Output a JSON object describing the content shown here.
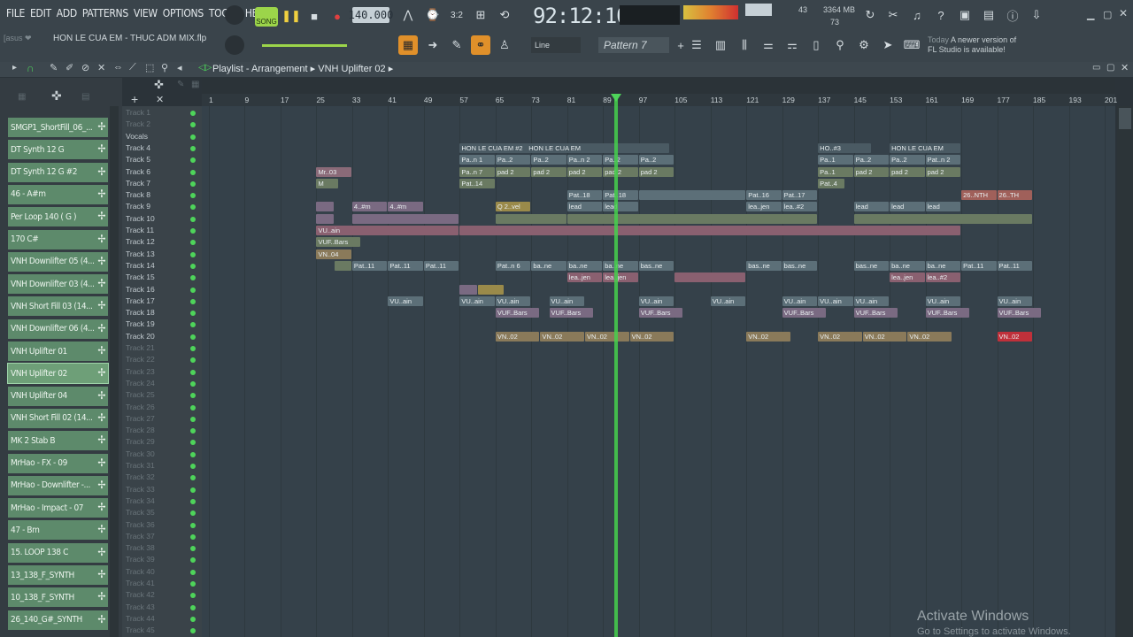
{
  "menu": [
    "FILE",
    "EDIT",
    "ADD",
    "PATTERNS",
    "VIEW",
    "OPTIONS",
    "TOOLS",
    "HELP"
  ],
  "transport": {
    "mode_label": "SONG",
    "tempo": "140.000",
    "time": "92:12:10",
    "cpu": "43",
    "mem": "3364 MB",
    "voices": "73"
  },
  "project": {
    "user": "[asus ❤",
    "file": "HON LE CUA EM - THUC ADM MIX.flp",
    "snap": "Line",
    "pattern": "Pattern 7"
  },
  "news": {
    "line1_prefix": "Today",
    "line1": "A newer version of",
    "line2": "FL Studio is available!"
  },
  "window": {
    "title": "Playlist - Arrangement",
    "sub": "VNH Uplifter 02"
  },
  "browser": [
    "SMGP1_ShortFill_06_...",
    "DT Synth 12 G",
    "DT Synth 12 G #2",
    "46 - A#m",
    "Per Loop 140 ( G )",
    "170 C#",
    "VNH Downlifter 05 (4...",
    "VNH Downlifter 03 (4...",
    "VNH Short Fill 03 (14...",
    "VNH Downlifter 06 (4...",
    "VNH Uplifter 01",
    "VNH Uplifter 02",
    "VNH Uplifter 04",
    "VNH Short Fill 02 (14...",
    "MK 2 Stab B",
    "MrHao - FX - 09",
    "MrHao - Downlifter -...",
    "MrHao - Impact - 07",
    "47 - Bm",
    "15. LOOP 138 C",
    "13_138_F_SYNTH",
    "10_138_F_SYNTH",
    "26_140_G#_SYNTH"
  ],
  "tracks": [
    "Track 1",
    "Track 2",
    "Vocals",
    "Track 4",
    "Track 5",
    "Track 6",
    "Track 7",
    "Track 8",
    "Track 9",
    "Track 10",
    "Track 11",
    "Track 12",
    "Track 13",
    "Track 14",
    "Track 15",
    "Track 16",
    "Track 17",
    "Track 18",
    "Track 19",
    "Track 20",
    "Track 21",
    "Track 22",
    "Track 23",
    "Track 24",
    "Track 25",
    "Track 26",
    "Track 27",
    "Track 28",
    "Track 29",
    "Track 30",
    "Track 31",
    "Track 32",
    "Track 33",
    "Track 34",
    "Track 35",
    "Track 36",
    "Track 37",
    "Track 38",
    "Track 39",
    "Track 40",
    "Track 41",
    "Track 42",
    "Track 43",
    "Track 44",
    "Track 45"
  ],
  "ruler": [
    "1",
    "9",
    "17",
    "25",
    "33",
    "41",
    "49",
    "57",
    "65",
    "73",
    "81",
    "89",
    "97",
    "105",
    "113",
    "121",
    "129",
    "137",
    "145",
    "153",
    "161",
    "169",
    "177",
    "185",
    "193",
    "201"
  ],
  "clips": [
    {
      "row": 3,
      "b": 57,
      "w": 16,
      "label": "HON LE CUA EM #2",
      "c": "#4a5a63"
    },
    {
      "row": 3,
      "b": 72,
      "w": 32,
      "label": "HON LE CUA EM",
      "c": "#4a5a63"
    },
    {
      "row": 3,
      "b": 137,
      "w": 12,
      "label": "HO..#3",
      "c": "#4a5a63"
    },
    {
      "row": 3,
      "b": 153,
      "w": 16,
      "label": "HON LE CUA EM",
      "c": "#4a5a63"
    },
    {
      "row": 4,
      "b": 57,
      "w": 8,
      "label": "Pa..n 1",
      "c": "#5c6f78"
    },
    {
      "row": 4,
      "b": 65,
      "w": 8,
      "label": "Pa..2",
      "c": "#5c6f78"
    },
    {
      "row": 4,
      "b": 73,
      "w": 8,
      "label": "Pa..2",
      "c": "#5c6f78"
    },
    {
      "row": 4,
      "b": 81,
      "w": 8,
      "label": "Pa..n 2",
      "c": "#5c6f78"
    },
    {
      "row": 4,
      "b": 89,
      "w": 8,
      "label": "Pa..2",
      "c": "#5c6f78"
    },
    {
      "row": 4,
      "b": 97,
      "w": 8,
      "label": "Pa..2",
      "c": "#5c6f78"
    },
    {
      "row": 4,
      "b": 137,
      "w": 8,
      "label": "Pa..1",
      "c": "#5c6f78"
    },
    {
      "row": 4,
      "b": 145,
      "w": 8,
      "label": "Pa..2",
      "c": "#5c6f78"
    },
    {
      "row": 4,
      "b": 153,
      "w": 8,
      "label": "Pa..2",
      "c": "#5c6f78"
    },
    {
      "row": 4,
      "b": 161,
      "w": 8,
      "label": "Pat..n 2",
      "c": "#5c6f78"
    },
    {
      "row": 5,
      "b": 25,
      "w": 8,
      "label": "Mr..03",
      "c": "#8a6a78"
    },
    {
      "row": 5,
      "b": 57,
      "w": 8,
      "label": "Pa..n 7",
      "c": "#6a7a62"
    },
    {
      "row": 5,
      "b": 65,
      "w": 8,
      "label": "pad 2",
      "c": "#6a7a62"
    },
    {
      "row": 5,
      "b": 73,
      "w": 8,
      "label": "pad 2",
      "c": "#6a7a62"
    },
    {
      "row": 5,
      "b": 81,
      "w": 8,
      "label": "pad 2",
      "c": "#6a7a62"
    },
    {
      "row": 5,
      "b": 89,
      "w": 8,
      "label": "pad 2",
      "c": "#6a7a62"
    },
    {
      "row": 5,
      "b": 97,
      "w": 8,
      "label": "pad 2",
      "c": "#6a7a62"
    },
    {
      "row": 5,
      "b": 137,
      "w": 8,
      "label": "Pa..1",
      "c": "#6a7a62"
    },
    {
      "row": 5,
      "b": 145,
      "w": 8,
      "label": "pad 2",
      "c": "#6a7a62"
    },
    {
      "row": 5,
      "b": 153,
      "w": 8,
      "label": "pad 2",
      "c": "#6a7a62"
    },
    {
      "row": 5,
      "b": 161,
      "w": 8,
      "label": "pad 2",
      "c": "#6a7a62"
    },
    {
      "row": 6,
      "b": 25,
      "w": 5,
      "label": "M",
      "c": "#6a7a62"
    },
    {
      "row": 6,
      "b": 57,
      "w": 8,
      "label": "Pat..14",
      "c": "#6a7a62"
    },
    {
      "row": 6,
      "b": 137,
      "w": 6,
      "label": "Pat..4",
      "c": "#6a7a62"
    },
    {
      "row": 7,
      "b": 81,
      "w": 8,
      "label": "Pat..18",
      "c": "#5c6f78"
    },
    {
      "row": 7,
      "b": 89,
      "w": 8,
      "label": "Pat..18",
      "c": "#5c6f78"
    },
    {
      "row": 7,
      "b": 97,
      "w": 24,
      "label": "",
      "c": "#5c6f78"
    },
    {
      "row": 7,
      "b": 121,
      "w": 8,
      "label": "Pat..16",
      "c": "#5c6f78"
    },
    {
      "row": 7,
      "b": 129,
      "w": 8,
      "label": "Pat..17",
      "c": "#5c6f78"
    },
    {
      "row": 7,
      "b": 169,
      "w": 8,
      "label": "26..NTH",
      "c": "#a0605a"
    },
    {
      "row": 7,
      "b": 177,
      "w": 8,
      "label": "26..TH",
      "c": "#a0605a"
    },
    {
      "row": 8,
      "b": 25,
      "w": 4,
      "label": "",
      "c": "#7a6a82"
    },
    {
      "row": 8,
      "b": 33,
      "w": 8,
      "label": "4..#m",
      "c": "#7a6a82"
    },
    {
      "row": 8,
      "b": 41,
      "w": 8,
      "label": "4..#m",
      "c": "#7a6a82"
    },
    {
      "row": 8,
      "b": 65,
      "w": 8,
      "label": "Q 2..vel",
      "c": "#9a8a4a"
    },
    {
      "row": 8,
      "b": 81,
      "w": 8,
      "label": "lead",
      "c": "#5c6f78"
    },
    {
      "row": 8,
      "b": 89,
      "w": 8,
      "label": "lead",
      "c": "#5c6f78"
    },
    {
      "row": 8,
      "b": 121,
      "w": 8,
      "label": "lea..jen",
      "c": "#5c6f78"
    },
    {
      "row": 8,
      "b": 129,
      "w": 8,
      "label": "lea..#2",
      "c": "#5c6f78"
    },
    {
      "row": 8,
      "b": 145,
      "w": 8,
      "label": "lead",
      "c": "#5c6f78"
    },
    {
      "row": 8,
      "b": 153,
      "w": 8,
      "label": "lead",
      "c": "#5c6f78"
    },
    {
      "row": 8,
      "b": 161,
      "w": 8,
      "label": "lead",
      "c": "#5c6f78"
    },
    {
      "row": 9,
      "b": 25,
      "w": 4,
      "label": "",
      "c": "#7a6a82"
    },
    {
      "row": 9,
      "b": 33,
      "w": 24,
      "label": "",
      "c": "#7a6a82"
    },
    {
      "row": 9,
      "b": 65,
      "w": 16,
      "label": "",
      "c": "#6a7a62"
    },
    {
      "row": 9,
      "b": 81,
      "w": 56,
      "label": "",
      "c": "#6a7a62"
    },
    {
      "row": 9,
      "b": 145,
      "w": 40,
      "label": "",
      "c": "#6a7a62"
    },
    {
      "row": 10,
      "b": 25,
      "w": 32,
      "label": "VU..ain",
      "c": "#8a6070"
    },
    {
      "row": 10,
      "b": 57,
      "w": 112,
      "label": "",
      "c": "#8a6070"
    },
    {
      "row": 11,
      "b": 25,
      "w": 10,
      "label": "VUF..Bars",
      "c": "#6a7a62"
    },
    {
      "row": 12,
      "b": 25,
      "w": 8,
      "label": "VN..04",
      "c": "#8a7a5a"
    },
    {
      "row": 13,
      "b": 29,
      "w": 4,
      "label": "",
      "c": "#6a7a62"
    },
    {
      "row": 13,
      "b": 33,
      "w": 8,
      "label": "Pat..11",
      "c": "#5c6f78"
    },
    {
      "row": 13,
      "b": 41,
      "w": 8,
      "label": "Pat..11",
      "c": "#5c6f78"
    },
    {
      "row": 13,
      "b": 49,
      "w": 8,
      "label": "Pat..11",
      "c": "#5c6f78"
    },
    {
      "row": 13,
      "b": 65,
      "w": 8,
      "label": "Pat..n 6",
      "c": "#5c6f78"
    },
    {
      "row": 13,
      "b": 73,
      "w": 8,
      "label": "ba..ne",
      "c": "#5c6f78"
    },
    {
      "row": 13,
      "b": 81,
      "w": 8,
      "label": "ba..ne",
      "c": "#5c6f78"
    },
    {
      "row": 13,
      "b": 89,
      "w": 8,
      "label": "ba..ne",
      "c": "#5c6f78"
    },
    {
      "row": 13,
      "b": 97,
      "w": 8,
      "label": "bas..ne",
      "c": "#5c6f78"
    },
    {
      "row": 13,
      "b": 121,
      "w": 8,
      "label": "bas..ne",
      "c": "#5c6f78"
    },
    {
      "row": 13,
      "b": 129,
      "w": 8,
      "label": "bas..ne",
      "c": "#5c6f78"
    },
    {
      "row": 13,
      "b": 145,
      "w": 8,
      "label": "bas..ne",
      "c": "#5c6f78"
    },
    {
      "row": 13,
      "b": 153,
      "w": 8,
      "label": "ba..ne",
      "c": "#5c6f78"
    },
    {
      "row": 13,
      "b": 161,
      "w": 8,
      "label": "ba..ne",
      "c": "#5c6f78"
    },
    {
      "row": 13,
      "b": 169,
      "w": 8,
      "label": "Pat..11",
      "c": "#5c6f78"
    },
    {
      "row": 13,
      "b": 177,
      "w": 8,
      "label": "Pat..11",
      "c": "#5c6f78"
    },
    {
      "row": 14,
      "b": 81,
      "w": 8,
      "label": "lea..jen",
      "c": "#8a6070"
    },
    {
      "row": 14,
      "b": 89,
      "w": 8,
      "label": "lea..jen",
      "c": "#8a6070"
    },
    {
      "row": 14,
      "b": 105,
      "w": 16,
      "label": "",
      "c": "#8a6070"
    },
    {
      "row": 14,
      "b": 153,
      "w": 8,
      "label": "lea..jen",
      "c": "#8a6070"
    },
    {
      "row": 14,
      "b": 161,
      "w": 8,
      "label": "lea..#2",
      "c": "#8a6070"
    },
    {
      "row": 15,
      "b": 57,
      "w": 4,
      "label": "",
      "c": "#7a6a82"
    },
    {
      "row": 15,
      "b": 61,
      "w": 6,
      "label": "",
      "c": "#9a8a4a"
    },
    {
      "row": 16,
      "b": 41,
      "w": 8,
      "label": "VU..ain",
      "c": "#5c6f78"
    },
    {
      "row": 16,
      "b": 57,
      "w": 8,
      "label": "VU..ain",
      "c": "#5c6f78"
    },
    {
      "row": 16,
      "b": 65,
      "w": 8,
      "label": "VU..ain",
      "c": "#5c6f78"
    },
    {
      "row": 16,
      "b": 77,
      "w": 8,
      "label": "VU..ain",
      "c": "#5c6f78"
    },
    {
      "row": 16,
      "b": 97,
      "w": 8,
      "label": "VU..ain",
      "c": "#5c6f78"
    },
    {
      "row": 16,
      "b": 113,
      "w": 8,
      "label": "VU..ain",
      "c": "#5c6f78"
    },
    {
      "row": 16,
      "b": 129,
      "w": 8,
      "label": "VU..ain",
      "c": "#5c6f78"
    },
    {
      "row": 16,
      "b": 137,
      "w": 8,
      "label": "VU..ain",
      "c": "#5c6f78"
    },
    {
      "row": 16,
      "b": 145,
      "w": 8,
      "label": "VU..ain",
      "c": "#5c6f78"
    },
    {
      "row": 16,
      "b": 161,
      "w": 8,
      "label": "VU..ain",
      "c": "#5c6f78"
    },
    {
      "row": 16,
      "b": 177,
      "w": 8,
      "label": "VU..ain",
      "c": "#5c6f78"
    },
    {
      "row": 17,
      "b": 65,
      "w": 10,
      "label": "VUF..Bars",
      "c": "#7a6a82"
    },
    {
      "row": 17,
      "b": 77,
      "w": 10,
      "label": "VUF..Bars",
      "c": "#7a6a82"
    },
    {
      "row": 17,
      "b": 97,
      "w": 10,
      "label": "VUF..Bars",
      "c": "#7a6a82"
    },
    {
      "row": 17,
      "b": 129,
      "w": 10,
      "label": "VUF..Bars",
      "c": "#7a6a82"
    },
    {
      "row": 17,
      "b": 145,
      "w": 10,
      "label": "VUF..Bars",
      "c": "#7a6a82"
    },
    {
      "row": 17,
      "b": 161,
      "w": 10,
      "label": "VUF..Bars",
      "c": "#7a6a82"
    },
    {
      "row": 17,
      "b": 177,
      "w": 10,
      "label": "VUF..Bars",
      "c": "#7a6a82"
    },
    {
      "row": 19,
      "b": 65,
      "w": 10,
      "label": "VN..02",
      "c": "#8a7a5a"
    },
    {
      "row": 19,
      "b": 75,
      "w": 10,
      "label": "VN..02",
      "c": "#8a7a5a"
    },
    {
      "row": 19,
      "b": 85,
      "w": 10,
      "label": "VN..02",
      "c": "#8a7a5a"
    },
    {
      "row": 19,
      "b": 95,
      "w": 10,
      "label": "VN..02",
      "c": "#8a7a5a"
    },
    {
      "row": 19,
      "b": 121,
      "w": 10,
      "label": "VN..02",
      "c": "#8a7a5a"
    },
    {
      "row": 19,
      "b": 137,
      "w": 10,
      "label": "VN..02",
      "c": "#8a7a5a"
    },
    {
      "row": 19,
      "b": 147,
      "w": 10,
      "label": "VN..02",
      "c": "#8a7a5a"
    },
    {
      "row": 19,
      "b": 157,
      "w": 10,
      "label": "VN..02",
      "c": "#8a7a5a"
    },
    {
      "row": 19,
      "b": 177,
      "w": 8,
      "label": "VN..02",
      "c": "#c0303a"
    }
  ],
  "watermark": {
    "line1": "Activate Windows",
    "line2": "Go to Settings to activate Windows."
  }
}
